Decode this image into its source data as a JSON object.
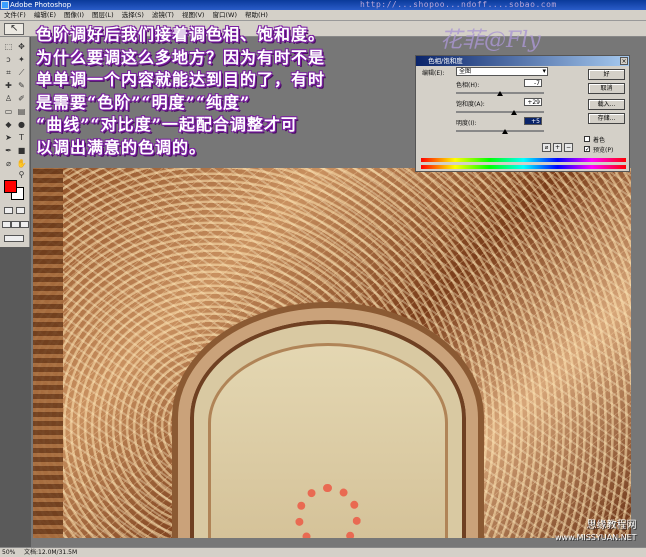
{
  "window": {
    "title": "Adobe Photoshop",
    "watermark_url": "http://...shopoo...ndoff....sobao.com"
  },
  "menu": [
    "文件(F)",
    "编辑(E)",
    "图像(I)",
    "图层(L)",
    "选择(S)",
    "滤镜(T)",
    "视图(V)",
    "窗口(W)",
    "帮助(H)"
  ],
  "caption_lines": [
    "色阶调好后我们接着调色相、饱和度。",
    "为什么要调这么多地方？因为有时不是",
    "单单调一个内容就能达到目的了，有时",
    "是需要“色阶”“明度”“纯度”",
    "“曲线”“对比度”一起配合调整才可",
    "以调出满意的色调的。"
  ],
  "logo_watermark": "花菲@Fly",
  "dialog": {
    "title": "色相/饱和度",
    "edit_label": "编辑(E):",
    "edit_value": "全图",
    "hue_label": "色相(H):",
    "hue_value": "-7",
    "saturation_label": "饱和度(A):",
    "saturation_value": "+29",
    "lightness_label": "明度(I):",
    "lightness_value": "+5",
    "ok": "好",
    "cancel": "取消",
    "load": "载入...",
    "save": "存储...",
    "colorize_label": "着色",
    "colorize_checked": false,
    "preview_label": "预览(P)",
    "preview_checked": true
  },
  "status": {
    "zoom": "50%",
    "doc_size": "文档:12.0M/31.5M"
  },
  "site_watermark": {
    "name": "思缘教程网",
    "url": "www.MISSYUAN.NET"
  },
  "colors": {
    "foreground": "#ff0000",
    "background": "#ffffff",
    "caption_outline": "#7b1fa2"
  }
}
